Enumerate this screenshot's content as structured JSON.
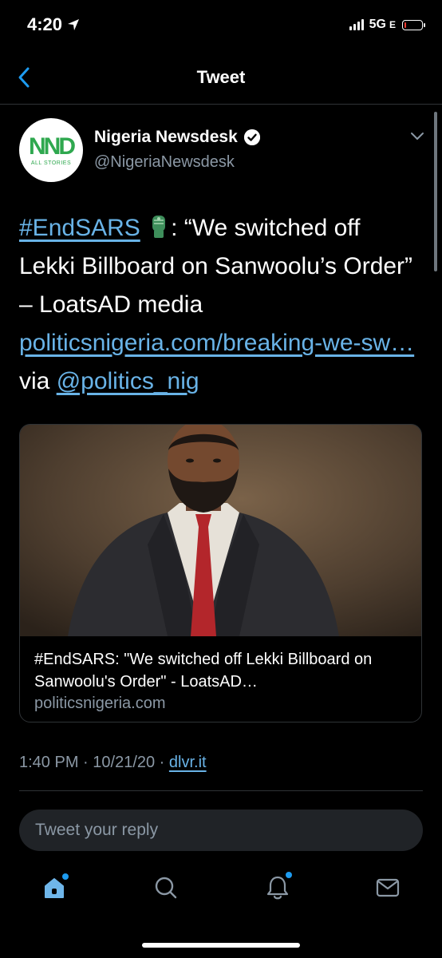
{
  "status_bar": {
    "time": "4:20",
    "network": "5G",
    "network_suffix": "E",
    "battery_level": 0.12
  },
  "header": {
    "title": "Tweet",
    "back_icon": "chevron-left-icon"
  },
  "author": {
    "name": "Nigeria Newsdesk",
    "handle": "@NigeriaNewsdesk",
    "avatar_text": "NND",
    "avatar_subtext": "ALL STORIES",
    "verified": true
  },
  "tweet": {
    "hashtag": "#EndSARS",
    "emoji": "raised-fist-emoji",
    "text_main": ": “We switched off Lekki Billboard on Sanwoolu’s Order” – LoatsAD media",
    "link_text": "politicsnigeria.com/breaking-we-sw…",
    "via_text": " via ",
    "mention": "@politics_nig"
  },
  "card": {
    "title": "#EndSARS: \"We switched off Lekki Billboard on Sanwoolu's Order\" - LoatsAD…",
    "domain": "politicsnigeria.com"
  },
  "meta": {
    "time": "1:40 PM",
    "date": "10/21/20",
    "separator": " · ",
    "source": "dlvr.it"
  },
  "reply": {
    "placeholder": "Tweet your reply"
  },
  "tab_bar": {
    "items": [
      "home-icon",
      "search-icon",
      "notifications-icon",
      "messages-icon"
    ]
  },
  "colors": {
    "background": "#000000",
    "link": "#69b3e7",
    "secondary_text": "#8b98a5",
    "accent": "#1d9bf0",
    "divider": "#2f3336"
  }
}
